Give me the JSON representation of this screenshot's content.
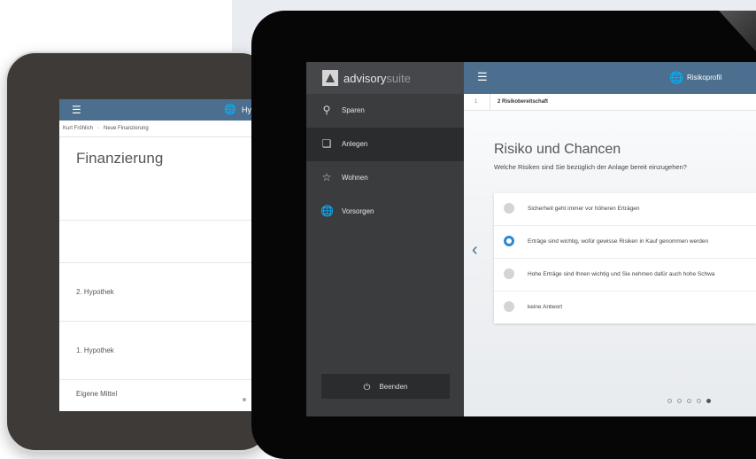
{
  "back": {
    "menu_icon": "hamburger-icon",
    "globe_icon": "globe-icon",
    "topbar_label": "Hy",
    "breadcrumb": [
      "Kurt Fröhlich",
      "Neue Finanzierung"
    ],
    "title": "Finanzierung",
    "rows": [
      "2. Hypothek",
      "1. Hypothek",
      "Eigene Mittel"
    ]
  },
  "front": {
    "app": {
      "brand_main": "advisory",
      "brand_suffix": "suite"
    },
    "nav": [
      {
        "label": "Sparen",
        "icon": "search-icon"
      },
      {
        "label": "Anlegen",
        "icon": "documents-icon"
      },
      {
        "label": "Wohnen",
        "icon": "star-icon"
      },
      {
        "label": "Vorsorgen",
        "icon": "globe-icon"
      }
    ],
    "active_nav": "Anlegen",
    "quit_label": "Beenden",
    "topbar_label": "Risikoprofil",
    "steps": {
      "first": "1",
      "current": "2  Risikobereitschaft"
    },
    "question": {
      "title": "Risiko und Chancen",
      "subtitle": "Welche Risiken sind Sie bezüglich der Anlage bereit einzugehen?"
    },
    "options": [
      {
        "label": "Sicherheit geht immer vor höheren Erträgen",
        "selected": false
      },
      {
        "label": "Erträge sind wichtig, wofür gewisse Risiken in Kauf genommen werden",
        "selected": true
      },
      {
        "label": "Hohe Erträge sind Ihnen wichtig und Sie nehmen dafür auch hohe Schwa",
        "selected": false
      },
      {
        "label": "keine Antwort",
        "selected": false
      }
    ],
    "pager": {
      "total": 5,
      "current": 5
    },
    "accent": "#2c87d6",
    "header_color": "#4c6f8f"
  }
}
